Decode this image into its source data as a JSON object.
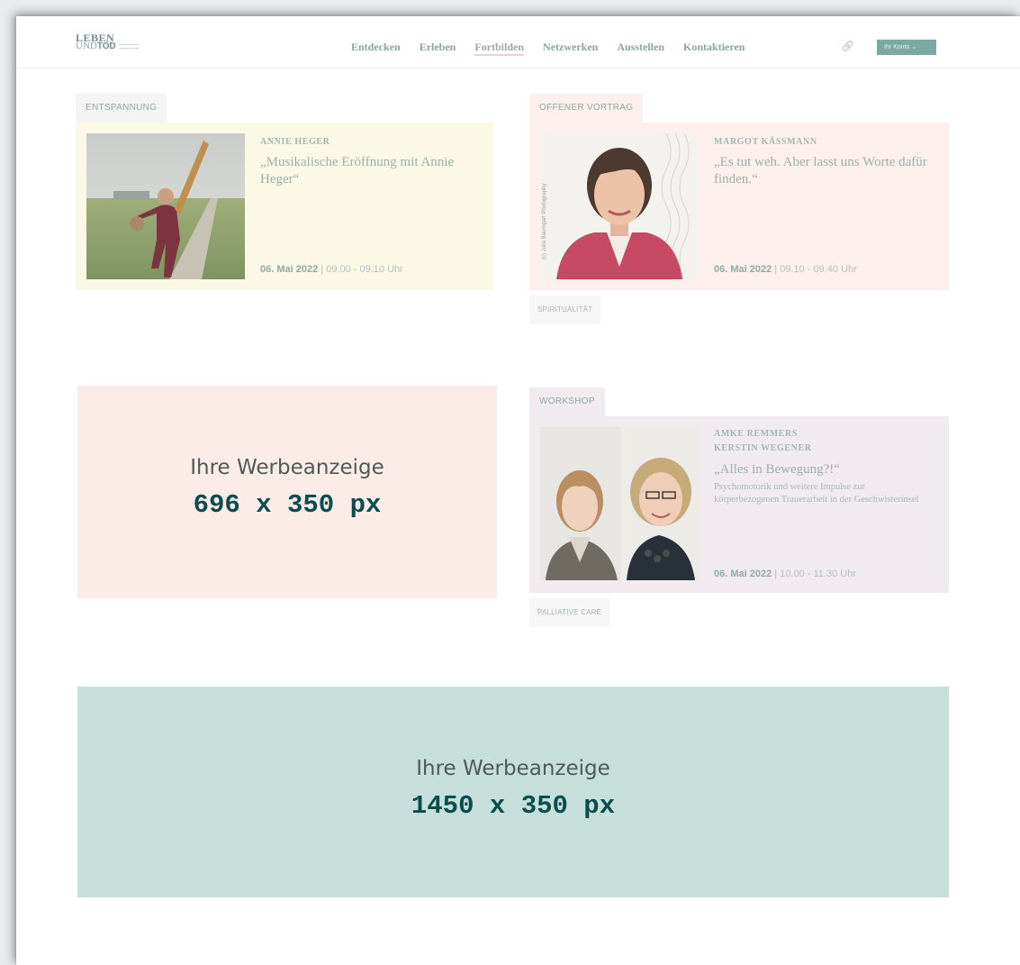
{
  "header": {
    "logo_top": "LEBEN",
    "logo_und": "UND",
    "logo_tod": "TOD",
    "nav": [
      "Entdecken",
      "Erleben",
      "Fortbilden",
      "Netzwerken",
      "Ausstellen",
      "Kontaktieren"
    ],
    "active_nav": "Fortbilden",
    "link_icon": "link-icon",
    "account_label": "Ihr Konto ⌄"
  },
  "events": [
    {
      "category": "ENTSPANNUNG",
      "speakers": [
        "ANNIE HEGER"
      ],
      "title": "„Musikalische Eröffnung mit Annie Heger“",
      "description": "",
      "date": "06. Mai 2022",
      "time": "| 09.00 - 09.10 Uhr",
      "tag": "",
      "bg": "#fbf8e6",
      "tab_bg": "#f4f4f4"
    },
    {
      "category": "OFFENER VORTRAG",
      "speakers": [
        "MARGOT KÄSSMANN"
      ],
      "title": "„Es tut weh. Aber lasst uns Worte dafür finden.“",
      "description": "",
      "date": "06. Mai 2022",
      "time": "| 09.10 - 09.40 Uhr",
      "tag": "SPIRITUALITÄT",
      "photo_credit": "(c) Julia Baumgart Photography",
      "bg": "#fdf0ec",
      "tab_bg": "#fdf0ec"
    },
    {
      "category": "WORKSHOP",
      "speakers": [
        "AMKE REMMERS",
        "KERSTIN WEGENER"
      ],
      "title": "„Alles in Bewegung?!“",
      "description": "Psychomotorik und weitere Impulse zur körperbezogenen Trauerarbeit in der Geschwisterinsel",
      "date": "06. Mai 2022",
      "time": "| 10.00 - 11.30 Uhr",
      "tag": "PALLIATIVE CARE",
      "bg": "#f1eaee",
      "tab_bg": "#f1eaee"
    }
  ],
  "ads": [
    {
      "label": "Ihre Werbeanzeige",
      "size": "696 x 350 px",
      "bg": "#fcece7"
    },
    {
      "label": "Ihre Werbeanzeige",
      "size": "1450 x 350 px",
      "bg": "#c7dfdb"
    }
  ],
  "colors": {
    "accent_dark": "#0b4d4f",
    "nav_text": "#8aa5a0",
    "account_button": "#7aa9a3"
  }
}
